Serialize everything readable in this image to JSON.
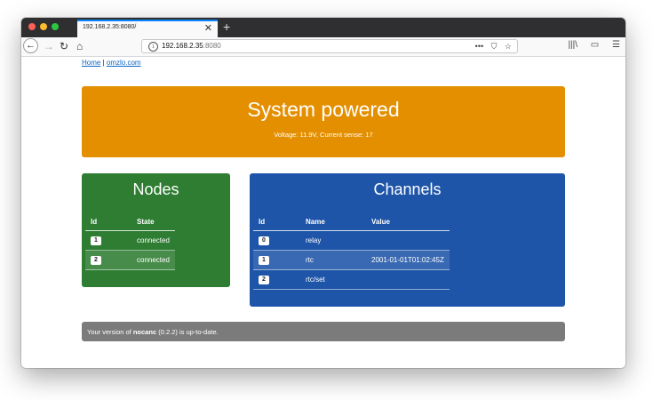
{
  "browser": {
    "tab_title": "192.168.2.35:8080/",
    "tab_close": "✕",
    "new_tab": "+",
    "url_host": "192.168.2.35",
    "url_port": ":8080",
    "url_actions": [
      "•••",
      "⛉",
      "☆"
    ],
    "right_icons": [
      "|||\\",
      "▭",
      "☰"
    ]
  },
  "links": {
    "home": "Home",
    "separator": " | ",
    "site": "omzlo.com"
  },
  "banner": {
    "title": "System powered",
    "subtitle": "Voltage: 11.9V, Current sense: 17",
    "color": "#e48f00"
  },
  "nodes": {
    "title": "Nodes",
    "headers": {
      "id": "Id",
      "state": "State"
    },
    "rows": [
      {
        "id": "1",
        "state": "connected"
      },
      {
        "id": "2",
        "state": "connected"
      }
    ],
    "color": "#2e7d32"
  },
  "channels": {
    "title": "Channels",
    "headers": {
      "id": "Id",
      "name": "Name",
      "value": "Value"
    },
    "rows": [
      {
        "id": "0",
        "name": "relay",
        "value": ""
      },
      {
        "id": "1",
        "name": "rtc",
        "value": "2001-01-01T01:02:45Z"
      },
      {
        "id": "2",
        "name": "rtc/set",
        "value": ""
      }
    ],
    "color": "#1e55a8"
  },
  "footer": {
    "prefix": "Your version of ",
    "app": "nocanc",
    "suffix": " (0.2.2) is up-to-date."
  }
}
